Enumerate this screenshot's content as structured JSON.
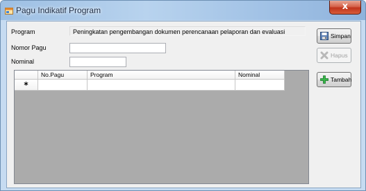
{
  "window": {
    "title": "Pagu Indikatif Program",
    "close_label": "x"
  },
  "form": {
    "program_label": "Program",
    "program_value": "Peningkatan pengembangan dokumen perencanaan pelaporan dan evaluasi",
    "nomor_pagu_label": "Nomor Pagu",
    "nomor_pagu_value": "",
    "nominal_label": "Nominal",
    "nominal_value": ""
  },
  "grid": {
    "columns": [
      "No.Pagu",
      "Program",
      "Nominal"
    ],
    "new_row_marker": "*",
    "rows": []
  },
  "buttons": {
    "simpan": "Simpan",
    "hapus": "Hapus",
    "tambah": "Tambah"
  },
  "icons": {
    "title": "form-app-icon",
    "simpan": "floppy-disk-icon",
    "hapus": "delete-x-icon",
    "tambah": "green-plus-icon"
  }
}
